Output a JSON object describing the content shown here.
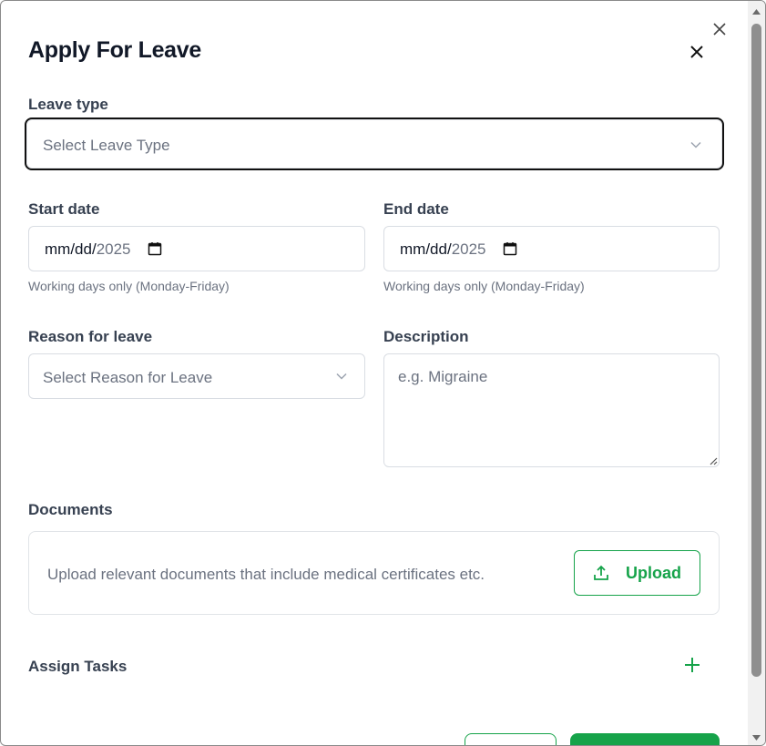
{
  "modal": {
    "title": "Apply For Leave"
  },
  "leave_type": {
    "label": "Leave type",
    "placeholder": "Select Leave Type"
  },
  "start_date": {
    "label": "Start date",
    "mmdd": "mm/dd/",
    "year": "2025",
    "hint": "Working days only (Monday-Friday)"
  },
  "end_date": {
    "label": "End date",
    "mmdd": "mm/dd/",
    "year": "2025",
    "hint": "Working days only (Monday-Friday)"
  },
  "reason": {
    "label": "Reason for leave",
    "placeholder": "Select Reason for Leave"
  },
  "description": {
    "label": "Description",
    "placeholder": "e.g. Migraine"
  },
  "documents": {
    "label": "Documents",
    "text": "Upload relevant documents that include medical certificates etc.",
    "upload_label": "Upload"
  },
  "tasks": {
    "label": "Assign Tasks"
  },
  "colors": {
    "accent": "#16a34a",
    "text": "#1f2937",
    "muted": "#6b7280",
    "border": "#d9dde3"
  },
  "icons": {
    "close": "close-icon",
    "chevron": "chevron-down-icon",
    "calendar": "calendar-icon",
    "upload": "upload-icon",
    "plus": "plus-icon"
  }
}
